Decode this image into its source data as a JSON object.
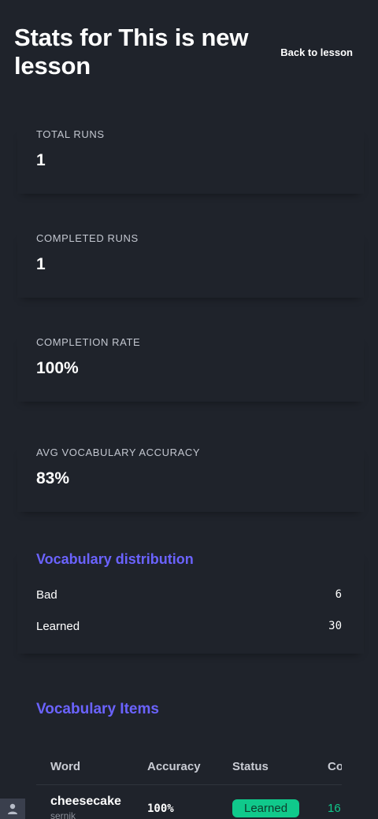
{
  "header": {
    "title": "Stats for This is new lesson",
    "back_label": "Back to lesson"
  },
  "stats": {
    "total_runs": {
      "label": "TOTAL RUNS",
      "value": "1"
    },
    "completed_runs": {
      "label": "COMPLETED RUNS",
      "value": "1"
    },
    "completion_rate": {
      "label": "COMPLETION RATE",
      "value": "100%"
    },
    "avg_vocab_accuracy": {
      "label": "AVG VOCABULARY ACCURACY",
      "value": "83%"
    }
  },
  "distribution": {
    "title": "Vocabulary distribution",
    "rows": [
      {
        "label": "Bad",
        "value": "6"
      },
      {
        "label": "Learned",
        "value": "30"
      }
    ]
  },
  "vocab_items": {
    "title": "Vocabulary Items",
    "columns": [
      "Word",
      "Accuracy",
      "Status",
      "Co"
    ],
    "rows": [
      {
        "word": "cheesecake",
        "sub": "sernik",
        "accuracy": "100%",
        "status": "Learned",
        "count": "16"
      }
    ]
  },
  "colors": {
    "background": "#1f232b",
    "accent": "#6b63ff",
    "success": "#10c98b"
  },
  "icons": {
    "avatar": "user-icon"
  }
}
